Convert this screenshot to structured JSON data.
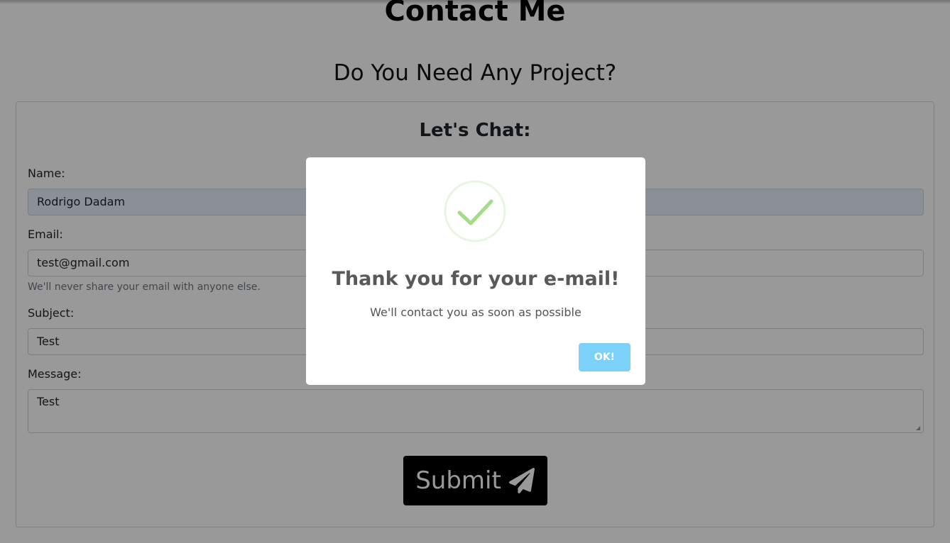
{
  "header": {
    "title": "Contact Me",
    "subtitle": "Do You Need Any Project?"
  },
  "form": {
    "heading": "Let's Chat:",
    "name": {
      "label": "Name:",
      "value": "Rodrigo Dadam"
    },
    "email": {
      "label": "Email:",
      "value": "test@gmail.com",
      "help": "We'll never share your email with anyone else."
    },
    "subject": {
      "label": "Subject:",
      "value": "Test"
    },
    "message": {
      "label": "Message:",
      "value": "Test"
    },
    "submit_label": "Submit",
    "submit_icon": "paper-plane-icon"
  },
  "modal": {
    "icon": "success-check-icon",
    "title": "Thank you for your e-mail!",
    "text": "We'll contact you as soon as possible",
    "ok_label": "OK!"
  },
  "colors": {
    "accent_button": "#7cd1f9",
    "success": "#a5dc86",
    "submit_bg": "#000000"
  }
}
